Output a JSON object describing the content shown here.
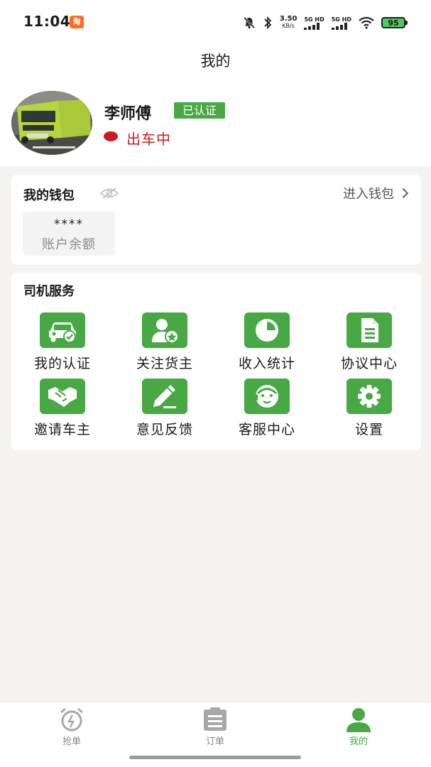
{
  "status_bar": {
    "time": "11:04",
    "app_badge": "淘",
    "net_speed": "3.50",
    "net_unit": "KB/s",
    "signal1": "5G HD",
    "signal2": "5G HD",
    "battery": "95"
  },
  "header": {
    "title": "我的"
  },
  "profile": {
    "name": "李师傅",
    "badge": "已认证",
    "status": "出车中",
    "status_color": "#cc1a1f"
  },
  "wallet": {
    "title": "我的钱包",
    "enter_label": "进入钱包",
    "balance_masked": "****",
    "balance_label": "账户余额"
  },
  "services": {
    "title": "司机服务",
    "items": [
      {
        "label": "我的认证",
        "icon": "car-check-icon"
      },
      {
        "label": "关注货主",
        "icon": "user-star-icon"
      },
      {
        "label": "收入统计",
        "icon": "pie-chart-icon"
      },
      {
        "label": "协议中心",
        "icon": "document-icon"
      },
      {
        "label": "邀请车主",
        "icon": "handshake-icon"
      },
      {
        "label": "意见反馈",
        "icon": "pencil-edit-icon"
      },
      {
        "label": "客服中心",
        "icon": "customer-service-icon"
      },
      {
        "label": "设置",
        "icon": "gear-icon"
      }
    ]
  },
  "bottom_nav": {
    "items": [
      {
        "label": "抢单",
        "icon": "alarm-clock-icon"
      },
      {
        "label": "订单",
        "icon": "clipboard-icon"
      },
      {
        "label": "我的",
        "icon": "person-icon",
        "active": true
      }
    ]
  },
  "colors": {
    "brand_green": "#47a844",
    "background": "#f4f3f2"
  }
}
